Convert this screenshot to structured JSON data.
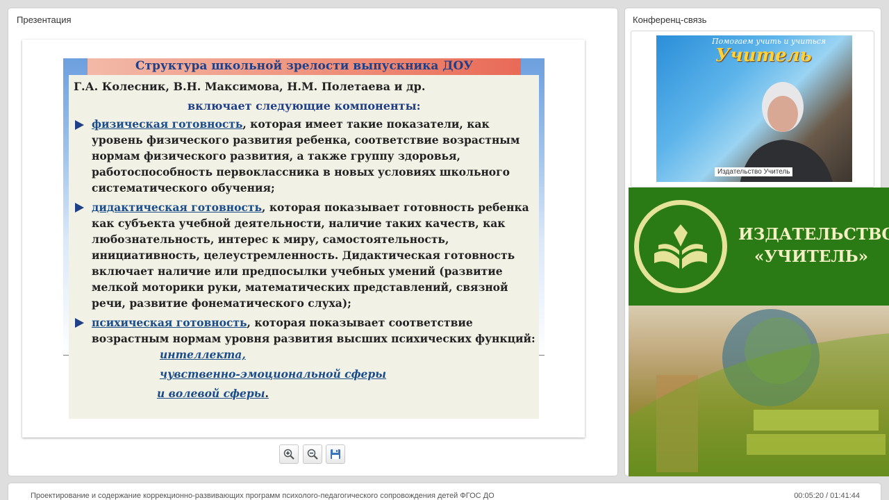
{
  "presentation": {
    "title": "Презентация",
    "slide": {
      "heading": "Структура школьной зрелости выпускника ДОУ",
      "authors": "Г.А. Колесник, В.Н. Максимова, Н.М. Полетаева и др.",
      "includes": "включает следующие компоненты:",
      "items": [
        {
          "term": "физическая готовность",
          "text": ", которая имеет такие показатели, как уровень физического развития ребенка, соответствие возрастным нормам физического развития, а также группу здоровья, работоспособность первоклассника в новых условиях школьного систематического обучения;"
        },
        {
          "term": "дидактическая готовность",
          "text": ", которая показывает готовность ребенка как субъекта учебной деятельности, наличие таких качеств, как любознательность, интерес к миру, самостоятельность, инициативность, целеустремленность. Дидактическая готовность включает наличие или предпосылки учебных умений (развитие мелкой моторики руки, математических представлений, связной речи, развитие фонематического слуха);"
        },
        {
          "term": "психическая готовность",
          "text": ", которая показывает соответствие возрастным нормам уровня развития высших психических функций:"
        }
      ],
      "sub_items": [
        "интеллекта,",
        "чувственно-эмоциональной сферы",
        "и волевой сферы"
      ],
      "sub_end": "."
    },
    "toolbar": {
      "zoom_in_icon": "zoom-in-icon",
      "zoom_out_icon": "zoom-out-icon",
      "save_icon": "floppy-disk-icon"
    }
  },
  "conference": {
    "title": "Конференц-связь",
    "video_label": "Издательство Учитель",
    "poster_top": "Помогаем учить и учиться",
    "poster_title": "Учитель"
  },
  "banner": {
    "line1": "ИЗДАТЕЛЬСТВО",
    "line2": "«УЧИТЕЛЬ»"
  },
  "footer": {
    "course": "Проектирование и содержание коррекционно-развивающих программ психолого-педагогического сопровождения детей ФГОС ДО",
    "time": "00:05:20 / 01:41:44"
  },
  "colors": {
    "accent_green": "#2a7a16",
    "slide_blue": "#1f3f87",
    "slide_bg": "#f2f1e6"
  }
}
